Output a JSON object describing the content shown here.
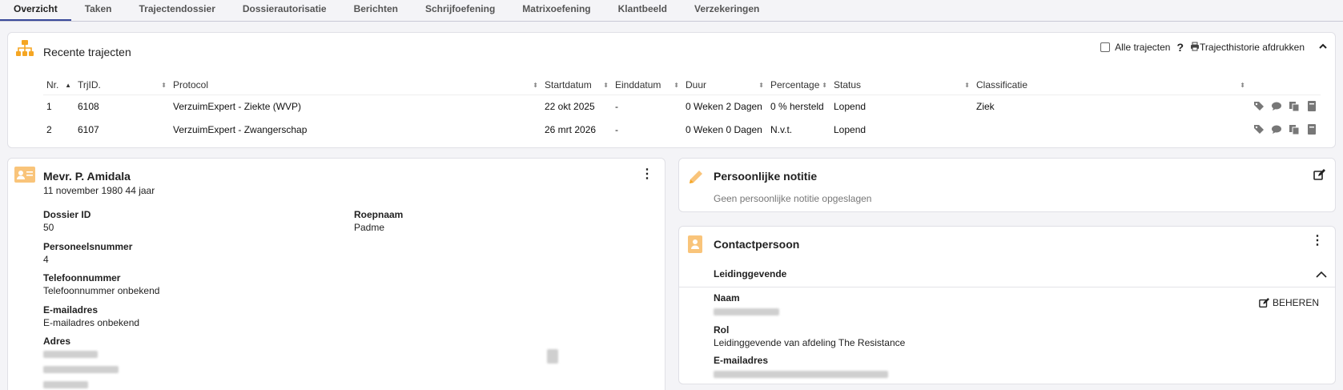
{
  "tabs": [
    {
      "label": "Overzicht",
      "active": true
    },
    {
      "label": "Taken"
    },
    {
      "label": "Trajectendossier"
    },
    {
      "label": "Dossierautorisatie"
    },
    {
      "label": "Berichten"
    },
    {
      "label": "Schrijfoefening"
    },
    {
      "label": "Matrixoefening"
    },
    {
      "label": "Klantbeeld"
    },
    {
      "label": "Verzekeringen"
    }
  ],
  "trajecten": {
    "title": "Recente trajecten",
    "all_label": "Alle trajecten",
    "help": "?",
    "print_label": "Trajecthistorie afdrukken",
    "columns": [
      "Nr.",
      "TrjID.",
      "Protocol",
      "Startdatum",
      "Einddatum",
      "Duur",
      "Percentage",
      "Status",
      "Classificatie"
    ],
    "rows": [
      {
        "nr": "1",
        "id": "6108",
        "protocol": "VerzuimExpert - Ziekte (WVP)",
        "start": "22 okt 2025",
        "end": "-",
        "duur": "0 Weken 2 Dagen",
        "percentage": "0 % hersteld",
        "status": "Lopend",
        "classificatie": "Ziek"
      },
      {
        "nr": "2",
        "id": "6107",
        "protocol": "VerzuimExpert - Zwangerschap",
        "start": "26 mrt 2026",
        "end": "-",
        "duur": "0 Weken 0 Dagen",
        "percentage": "N.v.t.",
        "status": "Lopend",
        "classificatie": ""
      }
    ]
  },
  "person": {
    "name": "Mevr. P. Amidala",
    "dob": "11 november 1980 44 jaar",
    "dossier_label": "Dossier ID",
    "dossier_value": "50",
    "roepnaam_label": "Roepnaam",
    "roepnaam_value": "Padme",
    "personeel_label": "Personeelsnummer",
    "personeel_value": "4",
    "telefoon_label": "Telefoonnummer",
    "telefoon_value": "Telefoonnummer onbekend",
    "email_label": "E-mailadres",
    "email_value": "E-mailadres onbekend",
    "adres_label": "Adres"
  },
  "note": {
    "title": "Persoonlijke notitie",
    "empty": "Geen persoonlijke notitie opgeslagen"
  },
  "contact": {
    "title": "Contactpersoon",
    "section": "Leidinggevende",
    "beheren": "BEHEREN",
    "naam_label": "Naam",
    "rol_label": "Rol",
    "rol_value": "Leidinggevende van afdeling The Resistance",
    "email_label": "E-mailadres"
  },
  "colors": {
    "accent": "#f5a623",
    "tab_active": "#3a4a9a"
  }
}
